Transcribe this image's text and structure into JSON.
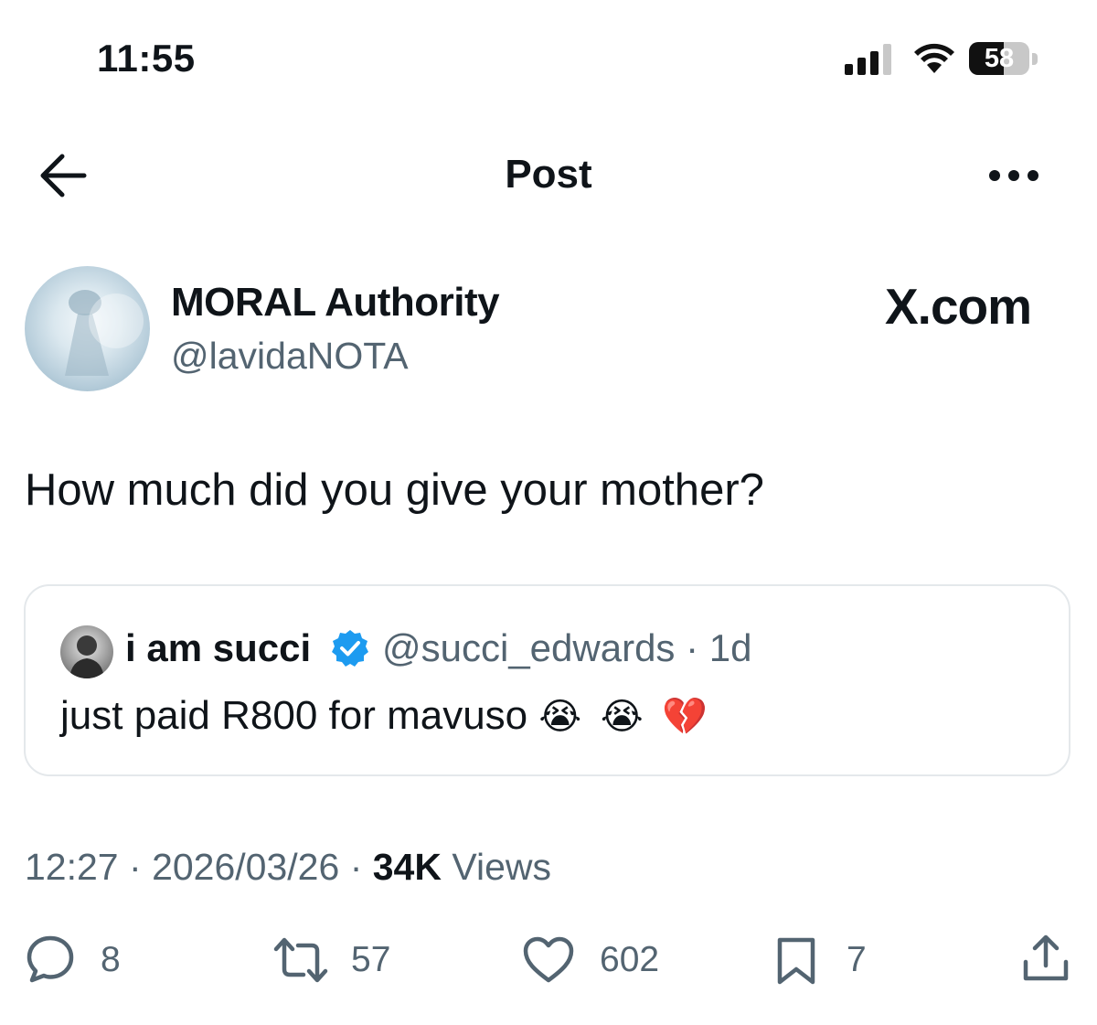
{
  "status_bar": {
    "time": "11:55",
    "battery": "58",
    "battery_level": 0.58
  },
  "nav": {
    "title": "Post"
  },
  "author": {
    "name": "MORAL Authority",
    "handle": "@lavidaNOTA"
  },
  "brand_watermark": "X.com",
  "post": {
    "text": "How much did you give your mother?"
  },
  "quoted_post": {
    "name": "i am succi",
    "handle": "@succi_edwards",
    "separator": "·",
    "age": "1d",
    "text": "just paid R800 for mavuso",
    "emojis": "😭 😭 💔"
  },
  "meta": {
    "time": "12:27",
    "date": "2026/03/26",
    "views_count": "34K",
    "views_label": "Views",
    "sep": "·"
  },
  "actions": {
    "replies": "8",
    "reposts": "57",
    "likes": "602",
    "bookmarks": "7"
  },
  "colors": {
    "text": "#0f1419",
    "secondary": "#536471",
    "verified": "#1d9bf0",
    "border": "#e4e8eb",
    "background": "#ffffff"
  },
  "icons": [
    "back-arrow-icon",
    "more-icon",
    "verified-icon",
    "reply-icon",
    "repost-icon",
    "like-icon",
    "bookmark-icon",
    "share-icon"
  ]
}
